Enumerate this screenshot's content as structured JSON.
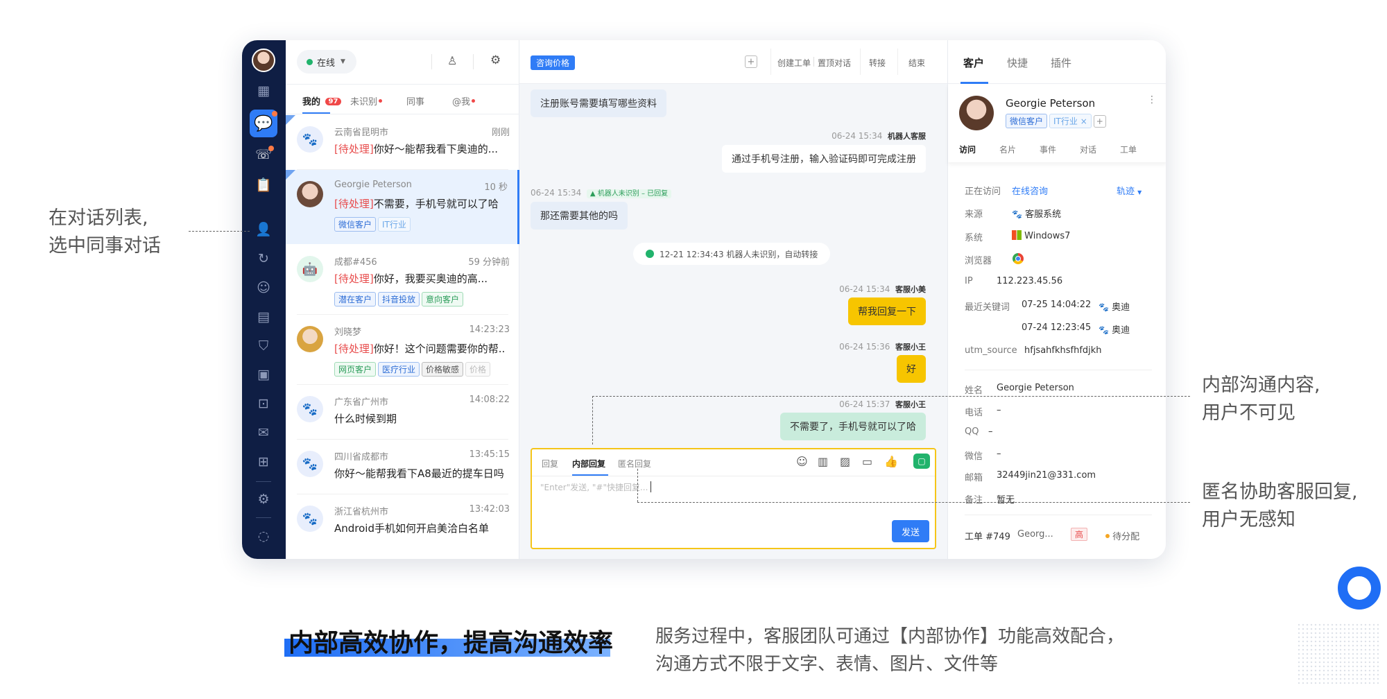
{
  "annotations": {
    "left_line1": "在对话列表,",
    "left_line2": "选中同事对话",
    "right1_line1": "内部沟通内容,",
    "right1_line2": "用户不可见",
    "right2_line1": "匿名协助客服回复,",
    "right2_line2": "用户无感知"
  },
  "footer": {
    "headline": "内部高效协作，提高沟通效率",
    "desc_line1": "服务过程中，客服团队可通过【内部协作】功能高效配合，",
    "desc_line2": "沟通方式不限于文字、表情、图片、文件等"
  },
  "list_header": {
    "status": "在线",
    "tabs": [
      {
        "label": "我的",
        "badge": "97"
      },
      {
        "label": "未识别"
      },
      {
        "label": "同事"
      },
      {
        "label": "@我"
      }
    ]
  },
  "conversations": [
    {
      "name": "云南省昆明市",
      "time": "刚刚",
      "status": "[待处理]",
      "text": "你好～能帮我看下奥迪的...",
      "tags": []
    },
    {
      "name": "Georgie Peterson",
      "time": "10 秒",
      "status": "[待处理]",
      "text": "不需要，手机号就可以了哈",
      "tags": [
        "微信客户",
        "IT行业"
      ]
    },
    {
      "name": "成都#456",
      "time": "59 分钟前",
      "status": "[待处理]",
      "text": "你好，我要买奥迪的高...",
      "tags": [
        "潜在客户",
        "抖音投放",
        "意向客户"
      ]
    },
    {
      "name": "刘晓梦",
      "time": "14:23:23",
      "status": "[待处理]",
      "text": "你好！这个问题需要你的帮...",
      "tags": [
        "网页客户",
        "医疗行业",
        "价格敏感",
        "价格"
      ]
    },
    {
      "name": "广东省广州市",
      "time": "14:08:22",
      "status": "",
      "text": "什么时候到期",
      "tags": []
    },
    {
      "name": "四川省成都市",
      "time": "13:45:15",
      "status": "",
      "text": "你好～能帮我看下A8最近的提车日吗",
      "tags": []
    },
    {
      "name": "浙江省杭州市",
      "time": "13:42:03",
      "status": "",
      "text": "Android手机如何开启美洽白名单",
      "tags": []
    }
  ],
  "chat_header": {
    "topic_tag": "咨询价格",
    "actions": [
      "创建工单",
      "置顶对话",
      "转接",
      "结束"
    ]
  },
  "messages": {
    "m1_text": "注册账号需要填写哪些资料",
    "m2_meta": "06-24 15:34",
    "m2_sender": "机器人客服",
    "m2_text": "通过手机号注册，输入验证码即可完成注册",
    "m3_meta": "06-24 15:34",
    "m3_flag": "机器人未识别 – 已回复",
    "m3_text": "那还需要其他的吗",
    "sys_text": "12-21 12:34:43  机器人未识别，自动转接",
    "m4_meta": "06-24 15:34",
    "m4_sender": "客服小美",
    "m4_text": "帮我回复一下",
    "m5_meta": "06-24 15:36",
    "m5_sender": "客服小王",
    "m5_text": "好",
    "m6_meta": "06-24 15:37",
    "m6_sender": "客服小王",
    "m6_text": "不需要了，手机号就可以了哈"
  },
  "composer": {
    "tabs": [
      "回复",
      "内部回复",
      "匿名回复"
    ],
    "placeholder": "\"Enter\"发送, \"#\"快捷回复...",
    "send": "发送"
  },
  "side_tabs": [
    "客户",
    "快捷",
    "插件"
  ],
  "customer": {
    "name": "Georgie Peterson",
    "tags": [
      "微信客户",
      "IT行业"
    ],
    "subtabs": [
      "访问",
      "名片",
      "事件",
      "对话",
      "工单"
    ],
    "visit_label": "正在访问",
    "visit_value": "在线咨询",
    "track": "轨迹",
    "source_label": "来源",
    "source_value": "客服系统",
    "os_label": "系统",
    "os_value": "Windows7",
    "browser_label": "浏览器",
    "ip_label": "IP",
    "ip_value": "112.223.45.56",
    "kw_label": "最近关键词",
    "kw1_time": "07-25 14:04:22",
    "kw1_word": "奥迪",
    "kw2_time": "07-24 12:23:45",
    "kw2_word": "奥迪",
    "utm_label": "utm_source",
    "utm_value": "hfjsahfkhsfhfdjkh",
    "fields": [
      {
        "label": "姓名",
        "value": "Georgie Peterson"
      },
      {
        "label": "电话",
        "value": "–"
      },
      {
        "label": "QQ",
        "value": "–"
      },
      {
        "label": "微信",
        "value": "–"
      },
      {
        "label": "邮箱",
        "value": "32449jin21@331.com"
      },
      {
        "label": "备注",
        "value": "暂无"
      }
    ],
    "ticket_no": "工单 #749",
    "ticket_name": "Georg...",
    "ticket_priority": "高",
    "ticket_status": "待分配"
  },
  "colors": {
    "accent": "#2f7cf6",
    "rail": "#0f1e44",
    "composer_border": "#f5c518",
    "yellow_bubble": "#f7c500",
    "green_bubble": "#c9ecdc"
  }
}
